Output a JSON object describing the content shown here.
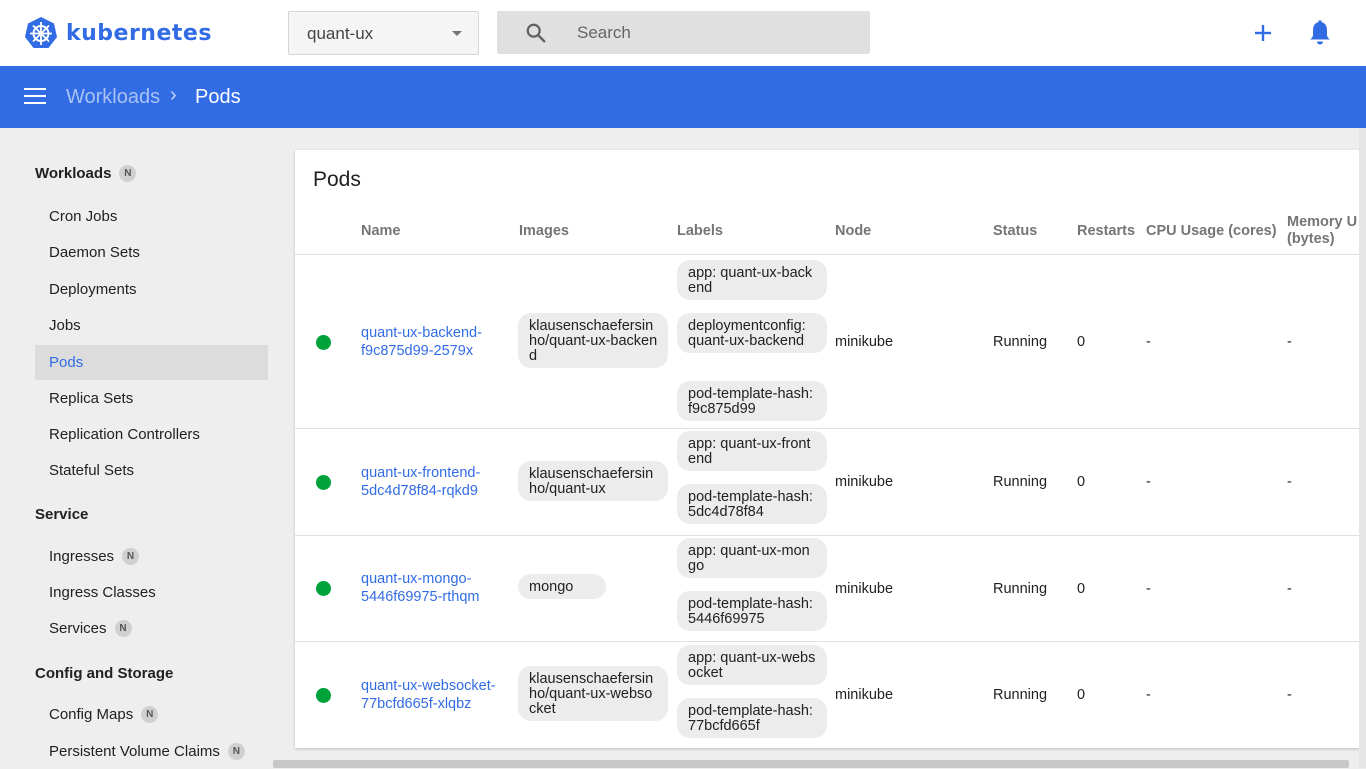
{
  "app": {
    "logo_text": "kubernetes",
    "brand_color": "#326ce5"
  },
  "header": {
    "namespace": "quant-ux",
    "search_placeholder": "Search",
    "create_icon": "plus-icon",
    "notifications_icon": "bell-icon"
  },
  "breadcrumb": {
    "parent": "Workloads",
    "separator": "›",
    "current": "Pods"
  },
  "sidebar": {
    "workloads_title": "Workloads",
    "workloads_badge": "N",
    "workloads_items": [
      {
        "label": "Cron Jobs"
      },
      {
        "label": "Daemon Sets"
      },
      {
        "label": "Deployments"
      },
      {
        "label": "Jobs"
      },
      {
        "label": "Pods",
        "active": true
      },
      {
        "label": "Replica Sets"
      },
      {
        "label": "Replication Controllers"
      },
      {
        "label": "Stateful Sets"
      }
    ],
    "service_title": "Service",
    "service_items": [
      {
        "label": "Ingresses",
        "badge": "N"
      },
      {
        "label": "Ingress Classes"
      },
      {
        "label": "Services",
        "badge": "N"
      }
    ],
    "config_title": "Config and Storage",
    "config_items": [
      {
        "label": "Config Maps",
        "badge": "N"
      },
      {
        "label": "Persistent Volume Claims",
        "badge": "N"
      }
    ]
  },
  "pods": {
    "title": "Pods",
    "columns": {
      "name": "Name",
      "images": "Images",
      "labels": "Labels",
      "node": "Node",
      "status": "Status",
      "restarts": "Restarts",
      "cpu": "CPU Usage (cores)",
      "memory_1": "Memory U",
      "memory_2": "(bytes)"
    },
    "rows": [
      {
        "name": "quant-ux-backend-f9c875d99-2579x",
        "image": "klausenschaefersinho/quant-ux-backend",
        "labels": [
          "app: quant-ux-backend",
          "deploymentconfig: quant-ux-backend",
          "pod-template-hash: f9c875d99"
        ],
        "node": "minikube",
        "status": "Running",
        "restarts": "0",
        "cpu": "-",
        "memory": "-"
      },
      {
        "name": "quant-ux-frontend-5dc4d78f84-rqkd9",
        "image": "klausenschaefersinho/quant-ux",
        "labels": [
          "app: quant-ux-frontend",
          "pod-template-hash: 5dc4d78f84"
        ],
        "node": "minikube",
        "status": "Running",
        "restarts": "0",
        "cpu": "-",
        "memory": "-"
      },
      {
        "name": "quant-ux-mongo-5446f69975-rthqm",
        "image": "mongo",
        "labels": [
          "app: quant-ux-mongo",
          "pod-template-hash: 5446f69975"
        ],
        "node": "minikube",
        "status": "Running",
        "restarts": "0",
        "cpu": "-",
        "memory": "-"
      },
      {
        "name": "quant-ux-websocket-77bcfd665f-xlqbz",
        "image": "klausenschaefersinho/quant-ux-websocket",
        "labels": [
          "app: quant-ux-websocket",
          "pod-template-hash: 77bcfd665f"
        ],
        "node": "minikube",
        "status": "Running",
        "restarts": "0",
        "cpu": "-",
        "memory": "-"
      }
    ]
  }
}
